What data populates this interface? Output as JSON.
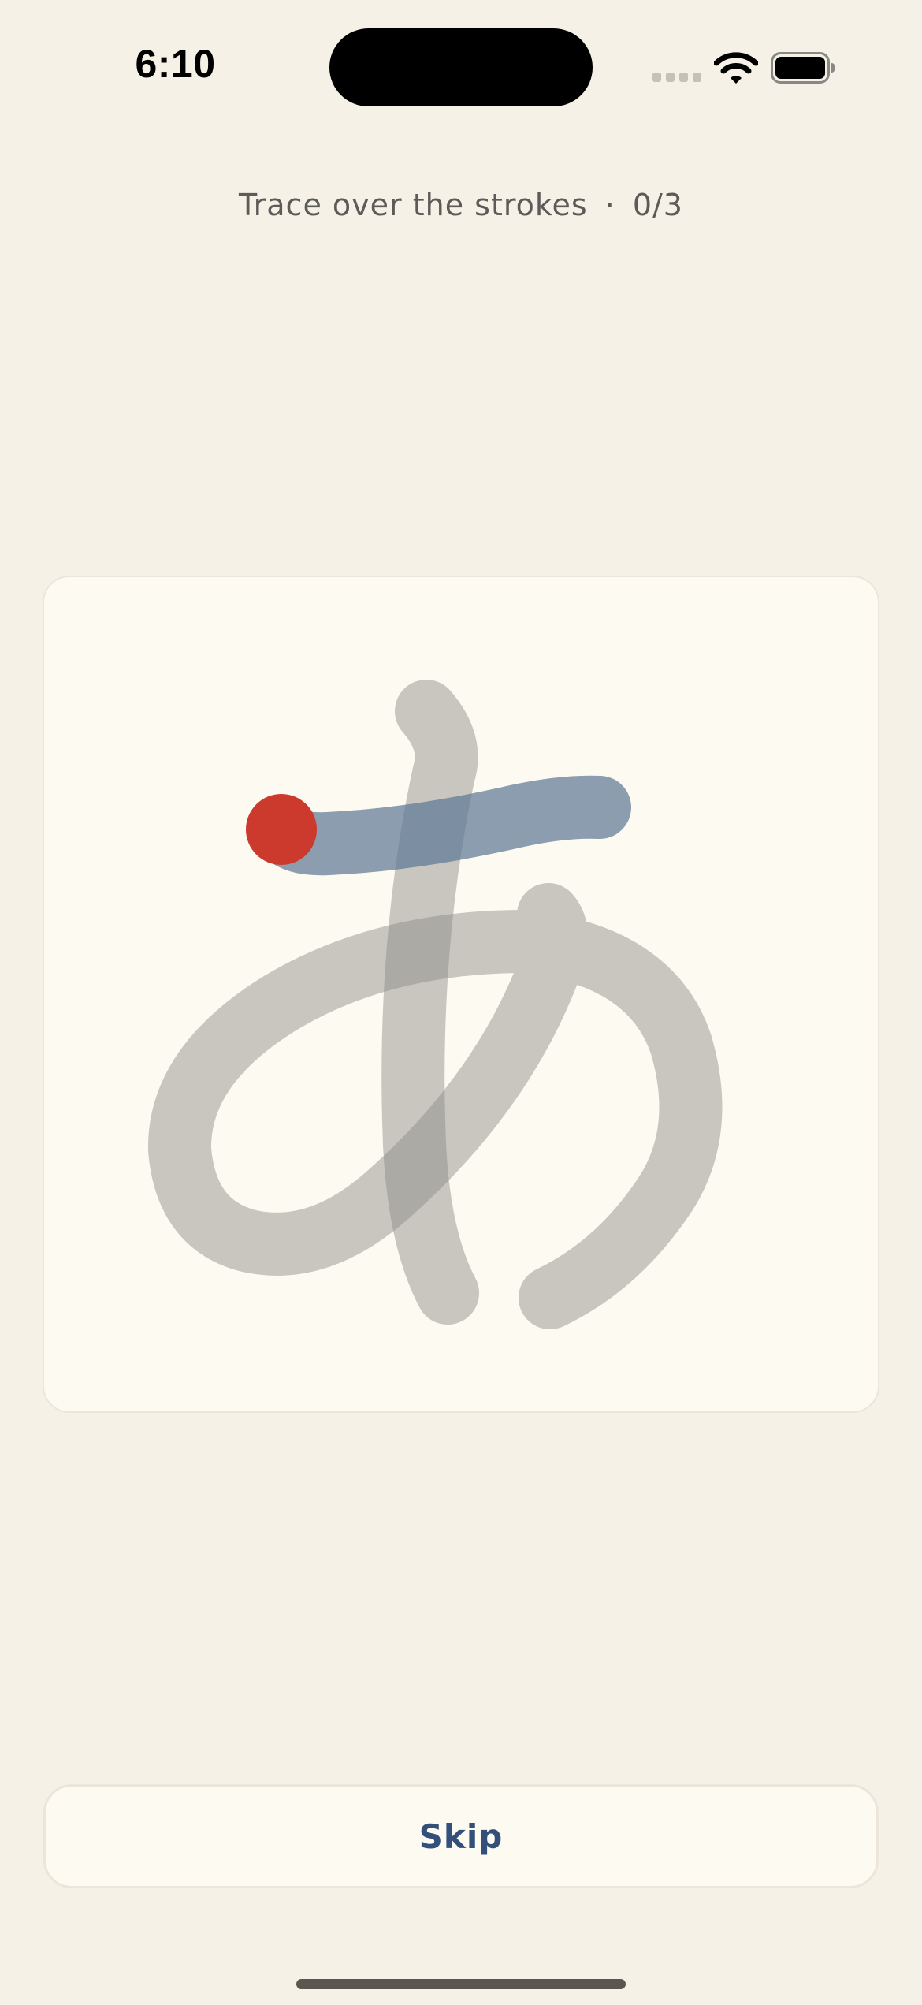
{
  "status_bar": {
    "time": "6:10",
    "cellular_icon": "cellular-signal-icon",
    "wifi_icon": "wifi-icon",
    "battery_icon": "battery-full-icon"
  },
  "prompt": {
    "instruction": "Trace over the strokes",
    "separator": "·",
    "progress": "0/3",
    "strokes_done": 0,
    "strokes_total": 3
  },
  "canvas": {
    "character": "あ",
    "active_stroke": 1,
    "colors": {
      "card_background": "#fdfaf1",
      "guide_stroke": "#c6c5c3",
      "active_stroke": "#8799aa",
      "start_dot": "#cb3a2c"
    }
  },
  "actions": {
    "skip_label": "Skip",
    "skip_color": "#34507a"
  },
  "colors": {
    "page_background": "#f5f1e6"
  }
}
